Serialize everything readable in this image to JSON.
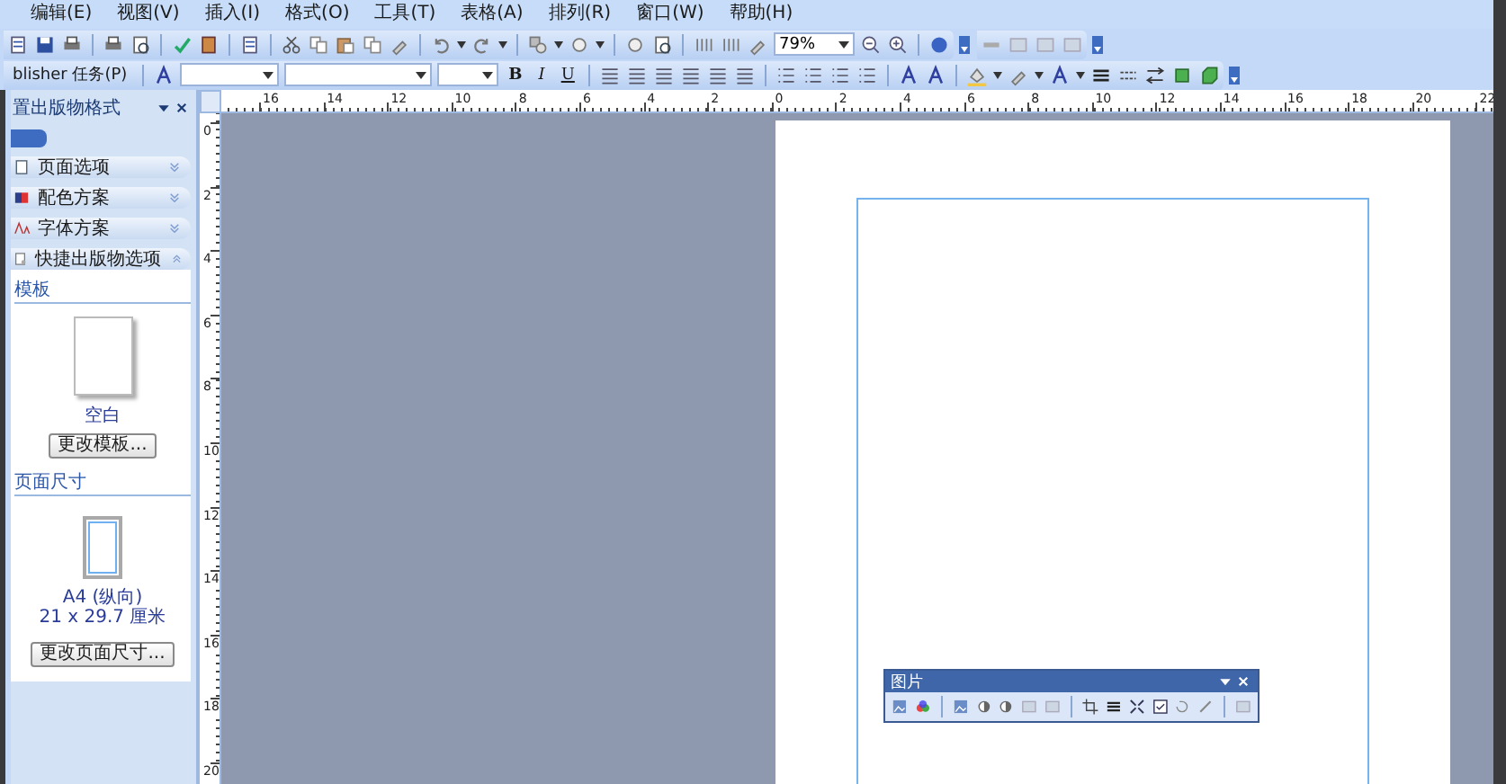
{
  "menu": [
    "编辑(E)",
    "视图(V)",
    "插入(I)",
    "格式(O)",
    "工具(T)",
    "表格(A)",
    "排列(R)",
    "窗口(W)",
    "帮助(H)"
  ],
  "standard_toolbar": {
    "zoom": "79%"
  },
  "formatting_toolbar": {
    "task_pane_button": "blisher 任务(P)",
    "bold": "B",
    "italic": "I",
    "underline": "U"
  },
  "task_pane": {
    "title": "置出版物格式",
    "sections": [
      {
        "label": "页面选项",
        "expanded": false
      },
      {
        "label": "配色方案",
        "expanded": false
      },
      {
        "label": "字体方案",
        "expanded": false
      },
      {
        "label": "快捷出版物选项",
        "expanded": true
      }
    ],
    "template_heading": "模板",
    "template_name": "空白",
    "change_template_button": "更改模板...",
    "page_size_heading": "页面尺寸",
    "page_size_name": "A4 (纵向)",
    "page_size_dimensions": "21 x 29.7 厘米",
    "change_page_size_button": "更改页面尺寸..."
  },
  "rulers": {
    "horizontal": [
      "16",
      "14",
      "12",
      "10",
      "8",
      "6",
      "4",
      "2",
      "0",
      "2",
      "4",
      "6",
      "8",
      "10",
      "12",
      "14",
      "16",
      "18",
      "20",
      "22"
    ],
    "vertical": [
      "0",
      "2",
      "4",
      "6",
      "8",
      "10",
      "12",
      "14",
      "16",
      "18",
      "20"
    ]
  },
  "picture_toolbar": {
    "title": "图片"
  }
}
